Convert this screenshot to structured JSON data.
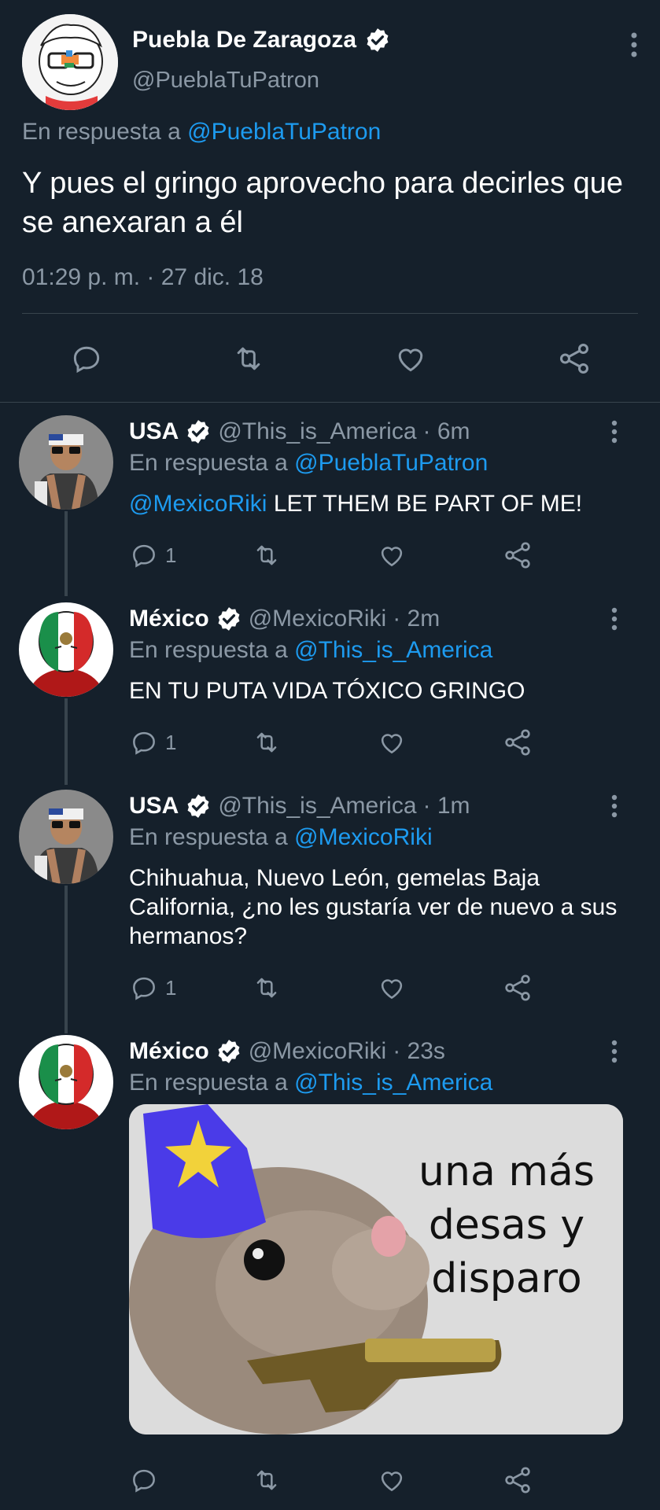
{
  "main_tweet": {
    "name": "Puebla De Zaragoza",
    "handle": "@PueblaTuPatron",
    "reply_prefix": "En respuesta a",
    "reply_to": "@PueblaTuPatron",
    "text": "Y pues el gringo aprovecho para decirles que se anexaran a él",
    "timestamp": "01:29 p. m. · 27 dic. 18"
  },
  "replies": [
    {
      "name": "USA",
      "handle": "@This_is_America",
      "age": "· 6m",
      "reply_prefix": "En respuesta a",
      "reply_to": "@PueblaTuPatron",
      "mention": "@MexicoRiki",
      "text": " LET THEM BE PART OF ME!",
      "reply_count": "1"
    },
    {
      "name": "México",
      "handle": "@MexicoRiki",
      "age": "· 2m",
      "reply_prefix": "En respuesta a",
      "reply_to": "@This_is_America",
      "text": "EN TU PUTA VIDA TÓXICO GRINGO",
      "reply_count": "1"
    },
    {
      "name": "USA",
      "handle": "@This_is_America",
      "age": "· 1m",
      "reply_prefix": "En respuesta a",
      "reply_to": "@MexicoRiki",
      "text": "Chihuahua, Nuevo León, gemelas Baja California, ¿no les gustaría ver de nuevo a sus hermanos?",
      "reply_count": "1"
    },
    {
      "name": "México",
      "handle": "@MexicoRiki",
      "age": "· 23s",
      "reply_prefix": "En respuesta a",
      "reply_to": "@This_is_America",
      "meme_caption": "una más desas y disparo"
    }
  ],
  "icons": {
    "reply": "comment-icon",
    "retweet": "retweet-icon",
    "like": "heart-icon",
    "share": "share-icon",
    "more": "more-vertical-icon",
    "verified": "verified-badge-icon"
  },
  "colors": {
    "background": "#15202b",
    "accent": "#1d9bf0",
    "muted": "#8b98a5",
    "divider": "#38444d"
  }
}
